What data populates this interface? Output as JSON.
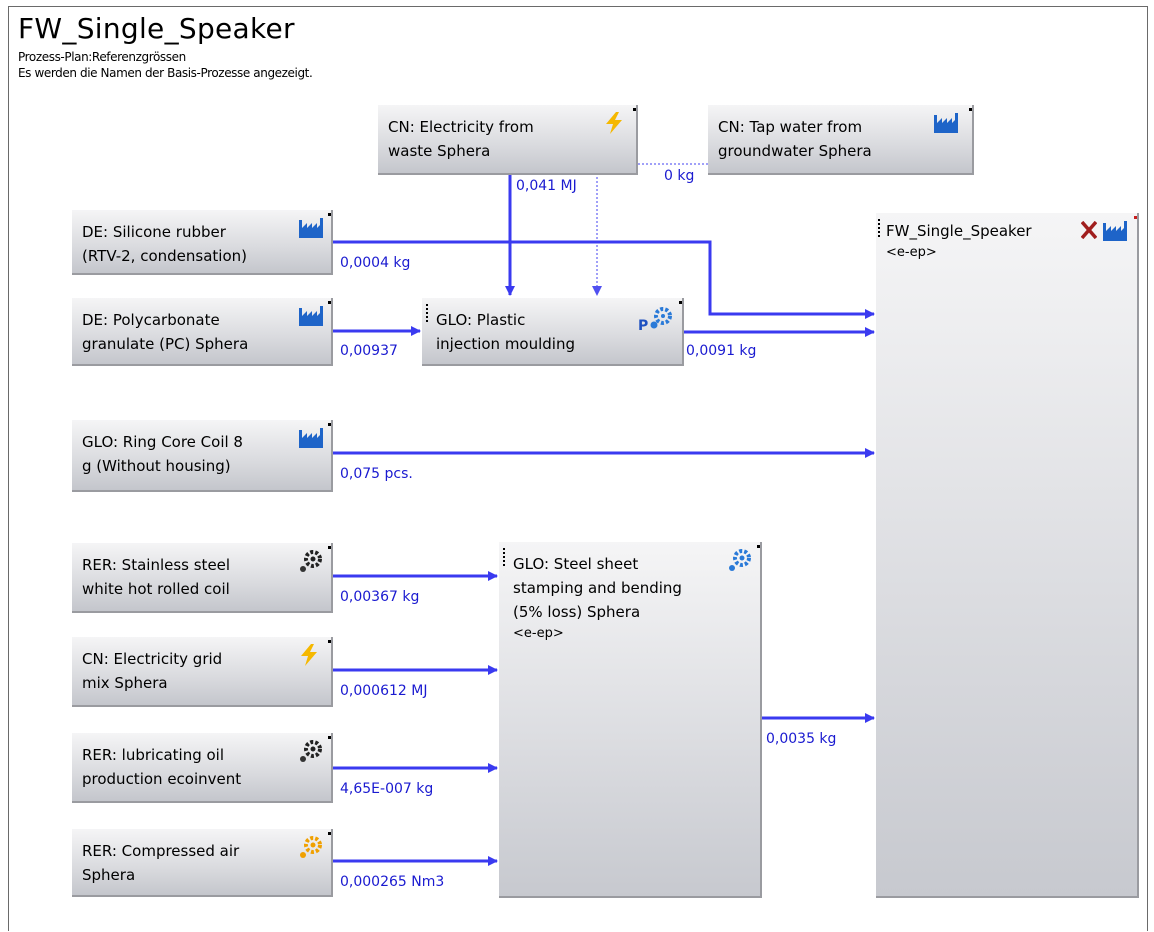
{
  "header": {
    "title": "FW_Single_Speaker",
    "line1": "Prozess-Plan:Referenzgrössen",
    "line2": "Es werden die Namen der Basis-Prozesse angezeigt."
  },
  "processes": {
    "cn_electricity_waste": "CN: Electricity from\nwaste Sphera",
    "cn_tap_water": "CN: Tap water from\ngroundwater Sphera",
    "de_silicone": "DE: Silicone rubber\n(RTV-2, condensation)",
    "de_polycarbonate": "DE: Polycarbonate\ngranulate (PC) Sphera",
    "glo_plastic": "GLO: Plastic\ninjection moulding",
    "glo_ring_core": "GLO: Ring Core Coil 8\ng (Without housing)",
    "rer_stainless": "RER: Stainless steel\nwhite hot rolled coil",
    "cn_electricity_grid": "CN: Electricity grid\nmix Sphera",
    "rer_lubricating": "RER: lubricating oil\nproduction ecoinvent",
    "rer_compressed_air": "RER: Compressed air\nSphera",
    "glo_steel_sheet": "GLO: Steel sheet\nstamping and bending\n(5% loss) Sphera",
    "glo_steel_sheet_tag": "<e-ep>",
    "fw_single_speaker": "FW_Single_Speaker",
    "fw_single_speaker_tag": "<e-ep>"
  },
  "flows": {
    "electricity_to_plastic": "0,041 MJ",
    "water_to_plastic": "0 kg",
    "silicone_to_speaker": "0,0004 kg",
    "pc_to_plastic": "0,00937",
    "plastic_to_speaker": "0,0091 kg",
    "ring_core_to_speaker": "0,075 pcs.",
    "stainless_to_steel": "0,00367 kg",
    "grid_to_steel": "0,000612 MJ",
    "lubricating_to_steel": "4,65E-007 kg",
    "air_to_steel": "0,000265 Nm3",
    "steel_to_speaker": "0,0035 kg"
  },
  "icons": {
    "factory": "factory-icon",
    "lightning": "lightning-icon",
    "gear": "gear-icon",
    "p_gear": "p-gear-icon",
    "x_mark": "x-mark-icon"
  },
  "colors": {
    "flow": "#3a3af0",
    "flow_text": "#1a1ad0",
    "factory": "#1e64c8",
    "lightning": "#f5b800",
    "gear_blue": "#2a7ad8",
    "gear_orange": "#f0a000",
    "x_mark": "#a01e1e"
  }
}
